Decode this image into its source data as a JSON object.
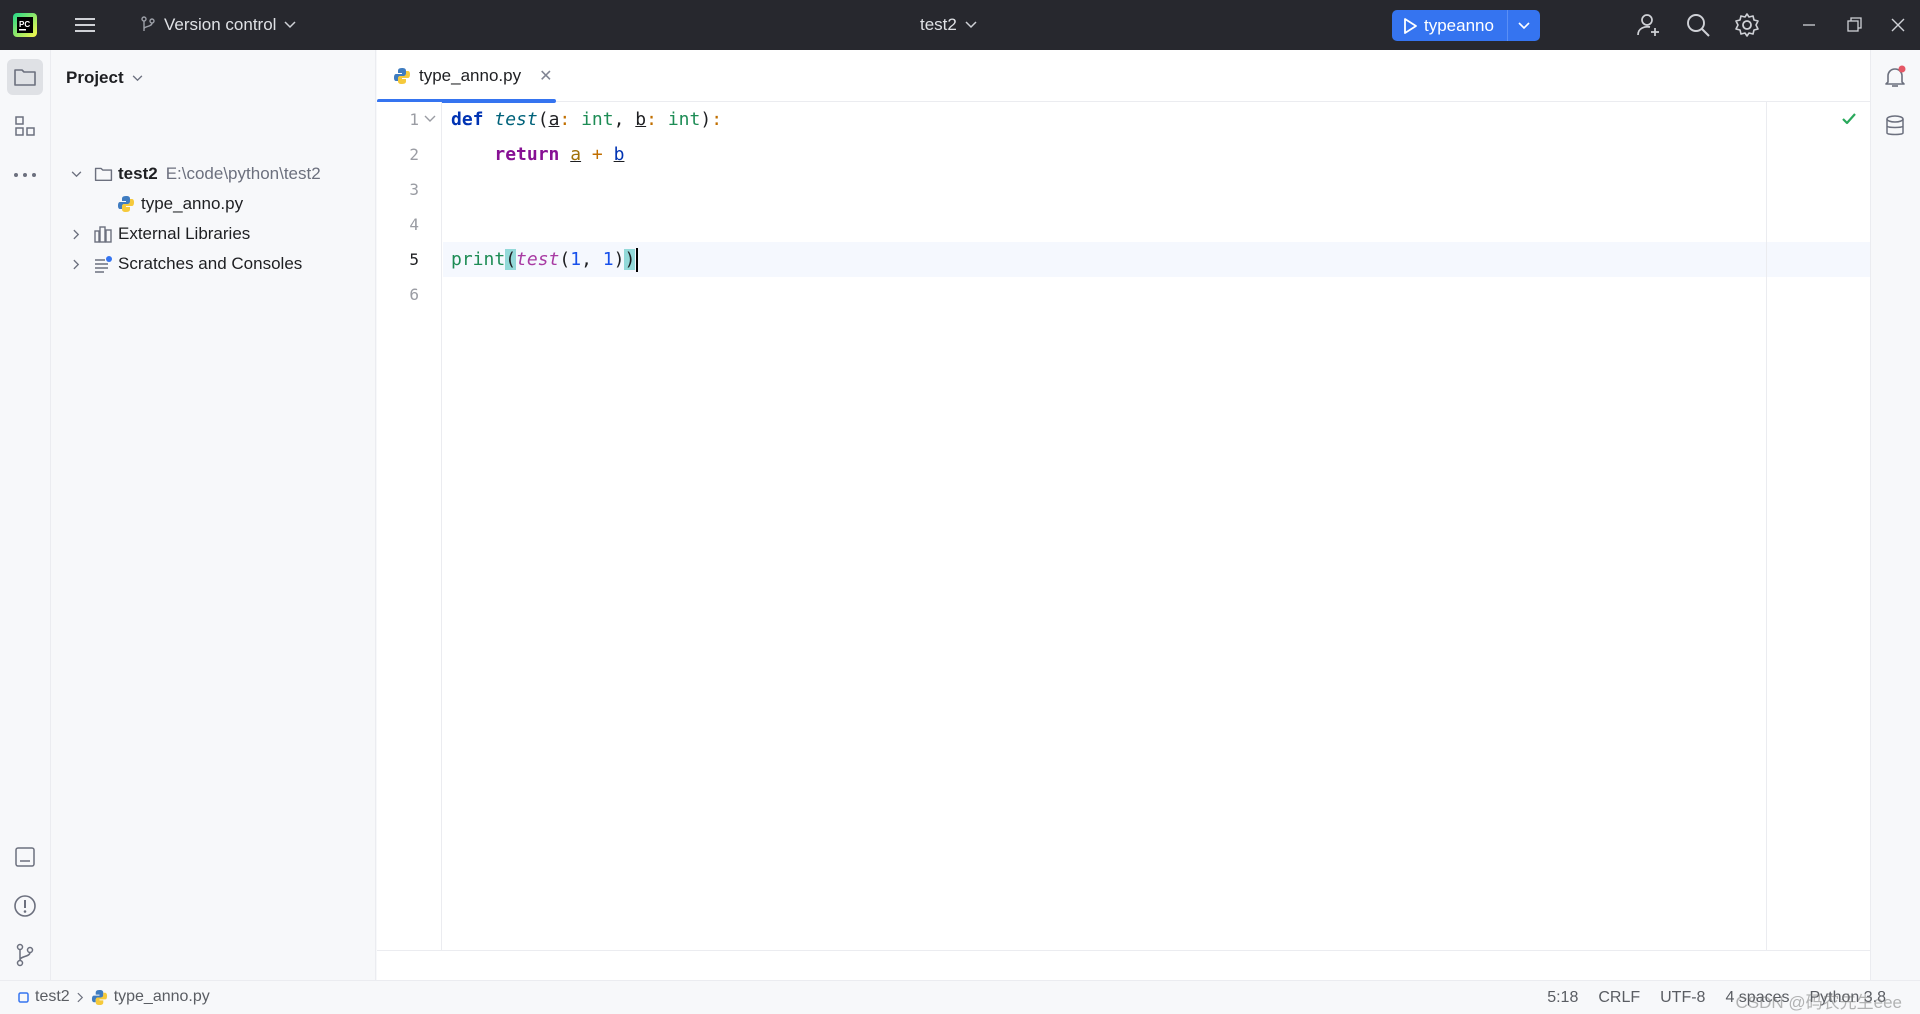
{
  "titlebar": {
    "vcs_label": "Version control",
    "project_name": "test2",
    "run_config": "typeanno"
  },
  "project_panel": {
    "title": "Project",
    "tree": [
      {
        "label": "test2",
        "path": "E:\\code\\python\\test2"
      },
      {
        "label": "type_anno.py"
      },
      {
        "label": "External Libraries"
      },
      {
        "label": "Scratches and Consoles"
      }
    ]
  },
  "editor": {
    "tab_label": "type_anno.py",
    "line_numbers": [
      "1",
      "2",
      "3",
      "4",
      "5",
      "6"
    ],
    "current_line": 5
  },
  "statusbar": {
    "crumb_project": "test2",
    "crumb_file": "type_anno.py",
    "position": "5:18",
    "line_ending": "CRLF",
    "encoding": "UTF-8",
    "indent": "4 spaces",
    "interpreter": "Python 3.8"
  },
  "watermark": "CSDN @码农先生eee",
  "icons": [
    "pycharm-logo-icon",
    "hamburger-menu-icon",
    "branch-icon",
    "chevron-down-icon",
    "play-icon",
    "add-user-icon",
    "search-icon",
    "gear-icon",
    "minimize-icon",
    "restore-icon",
    "close-icon",
    "folder-icon",
    "structure-icon",
    "more-icon",
    "terminal-icon",
    "problems-icon",
    "git-icon",
    "notification-icon",
    "database-icon",
    "python-file-icon",
    "library-icon",
    "scratches-icon",
    "check-icon"
  ],
  "colors": {
    "titlebar_bg": "#27282e",
    "accent": "#3574f0",
    "keyword": "#9b28b0",
    "builtin": "#1d8c55",
    "number": "#1750eb"
  }
}
